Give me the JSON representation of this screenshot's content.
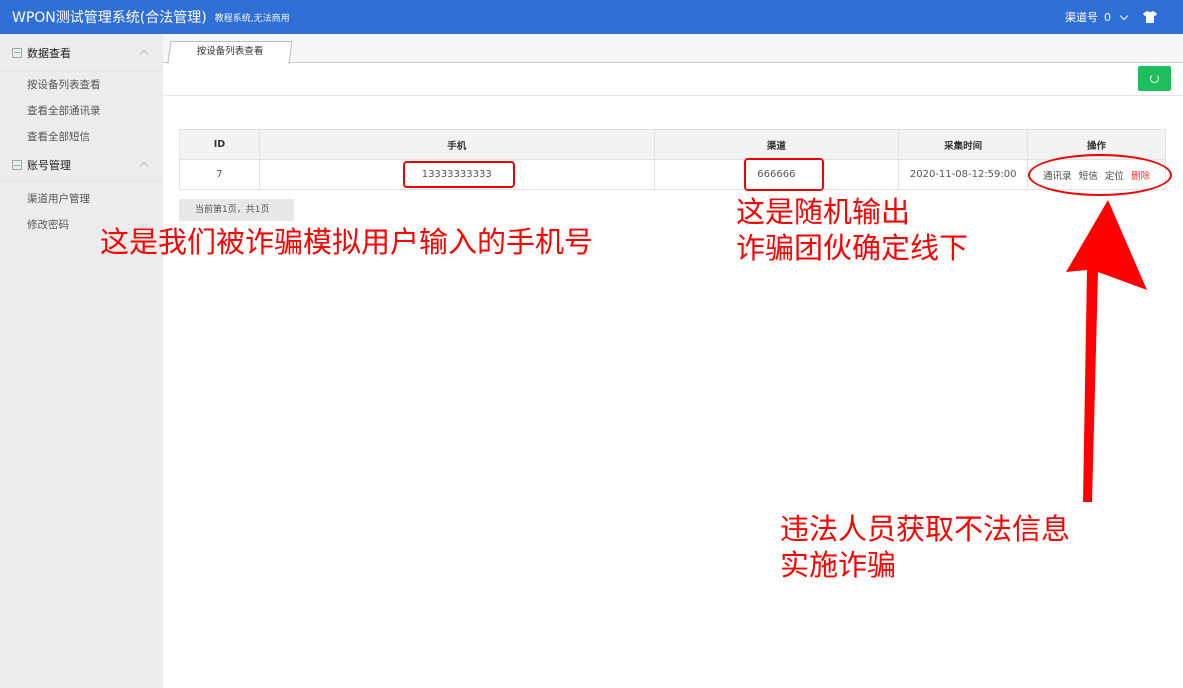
{
  "header": {
    "title": "WPON测试管理系统(合法管理)",
    "subtitle": "教程系统,无法商用",
    "channel_label": "渠道号",
    "channel_value": "0"
  },
  "sidebar": {
    "groups": [
      {
        "label": "数据查看",
        "items": [
          "按设备列表查看",
          "查看全部通讯录",
          "查看全部短信"
        ]
      },
      {
        "label": "账号管理",
        "items": [
          "渠道用户管理",
          "修改密码"
        ]
      }
    ]
  },
  "tab": {
    "label": "按设备列表查看"
  },
  "table": {
    "columns": [
      "ID",
      "手机",
      "渠道",
      "采集时间",
      "操作"
    ],
    "rows": [
      {
        "id": "7",
        "phone": "13333333333",
        "channel": "666666",
        "time": "2020-11-08-12:59:00",
        "actions": [
          "通讯录",
          "短信",
          "定位",
          "删除"
        ]
      }
    ]
  },
  "pager": {
    "text": "当前第1页，共1页"
  },
  "annotations": {
    "phone_note": "这是我们被诈骗模拟用户输入的手机号",
    "channel_note_line1": "这是随机输出",
    "channel_note_line2": "诈骗团伙确定线下",
    "action_note_line1": "违法人员获取不法信息",
    "action_note_line2": "实施诈骗"
  },
  "colors": {
    "header_bg": "#2f6fd6",
    "refresh_button": "#1fbe5c",
    "delete_link": "#e53333",
    "annotation": "#ff0000"
  },
  "icons": {
    "refresh_button": "refresh-icon",
    "header_right": "shirt-icon",
    "sidebar_group": "panel-icon"
  }
}
